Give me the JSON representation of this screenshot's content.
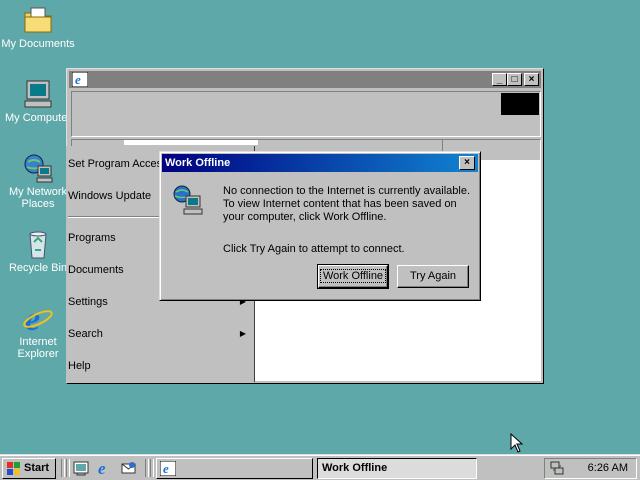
{
  "desktop": {
    "icons": [
      {
        "label": "My Documents",
        "icon": "folder-documents-icon"
      },
      {
        "label": "My Computer",
        "icon": "computer-icon"
      },
      {
        "label": "My Network Places",
        "icon": "network-places-icon"
      },
      {
        "label": "Recycle Bin",
        "icon": "recycle-bin-icon"
      },
      {
        "label": "Internet Explorer",
        "icon": "internet-explorer-icon"
      }
    ]
  },
  "start_menu": {
    "items": [
      {
        "label": "Set Program Access and Defaults",
        "submenu": false
      },
      {
        "label": "Windows Update",
        "submenu": false
      },
      {
        "label": "Programs",
        "submenu": true
      },
      {
        "label": "Documents",
        "submenu": true
      },
      {
        "label": "Settings",
        "submenu": true
      },
      {
        "label": "Search",
        "submenu": true
      },
      {
        "label": "Help",
        "submenu": false
      }
    ],
    "arrow_glyph": "▶"
  },
  "browser_window": {
    "title": "",
    "buttons": {
      "minimize": "_",
      "maximize": "□",
      "close": "×"
    }
  },
  "dialog": {
    "title": "Work Offline",
    "close_glyph": "×",
    "message_lines": [
      "No connection to the Internet is currently available.",
      "To view Internet content that has been saved on",
      "your computer, click Work Offline."
    ],
    "retry_hint": "Click Try Again to attempt to connect.",
    "buttons": {
      "work_offline": "Work Offline",
      "try_again": "Try Again"
    }
  },
  "taskbar": {
    "start_label": "Start",
    "quick_launch": [
      "show-desktop-icon",
      "internet-explorer-icon",
      "outlook-express-icon"
    ],
    "tasks": [
      {
        "label": "",
        "active": false
      },
      {
        "label": "Work Offline",
        "active": true
      }
    ],
    "clock": "6:26 AM"
  },
  "colors": {
    "desktop": "#5fa8a9",
    "title_active_start": "#000080",
    "title_active_end": "#1084d0",
    "title_inactive": "#808080",
    "face": "#c0c0c0"
  }
}
